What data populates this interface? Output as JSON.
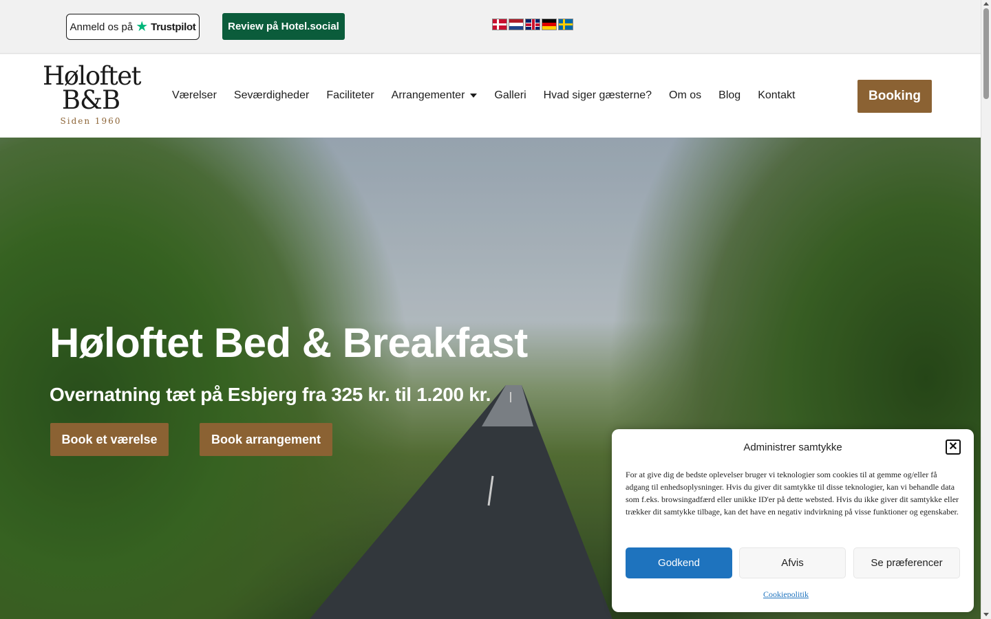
{
  "topbar": {
    "trustpilot_prefix": "Anmeld os på",
    "trustpilot_brand": "Trustpilot",
    "hotelsocial_label": "Review på Hotel.social",
    "flags": [
      {
        "name": "danish-flag",
        "lang": "da"
      },
      {
        "name": "dutch-flag",
        "lang": "nl"
      },
      {
        "name": "english-flag",
        "lang": "en"
      },
      {
        "name": "german-flag",
        "lang": "de"
      },
      {
        "name": "swedish-flag",
        "lang": "sv"
      }
    ]
  },
  "header": {
    "logo": {
      "line1": "Høloftet",
      "line2": "B&B",
      "tagline": "Siden 1960"
    },
    "nav": [
      "Værelser",
      "Seværdigheder",
      "Faciliteter",
      "Arrangementer",
      "Galleri",
      "Hvad siger gæsterne?",
      "Om os",
      "Blog",
      "Kontakt"
    ],
    "booking_label": "Booking"
  },
  "hero": {
    "title": "Høloftet Bed & Breakfast",
    "subtitle": "Overnatning tæt på Esbjerg fra 325 kr. til 1.200 kr.",
    "btn_room": "Book et værelse",
    "btn_event": "Book arrangement"
  },
  "cookie": {
    "title": "Administrer samtykke",
    "text": "For at give dig de bedste oplevelser bruger vi teknologier som cookies til at gemme og/eller få adgang til enhedsoplysninger. Hvis du giver dit samtykke til disse teknologier, kan vi behandle data som f.eks. browsingadfærd eller unikke ID'er på dette websted. Hvis du ikke giver dit samtykke eller trækker dit samtykke tilbage, kan det have en negativ indvirkning på visse funktioner og egenskaber.",
    "accept": "Godkend",
    "deny": "Afvis",
    "preferences": "Se præferencer",
    "policy_link": "Cookiepolitik"
  },
  "colors": {
    "brand_brown": "#8b6233",
    "hotelsocial_green": "#0b5c3b",
    "trustpilot_green": "#00b67a",
    "accept_blue": "#1e73be"
  }
}
